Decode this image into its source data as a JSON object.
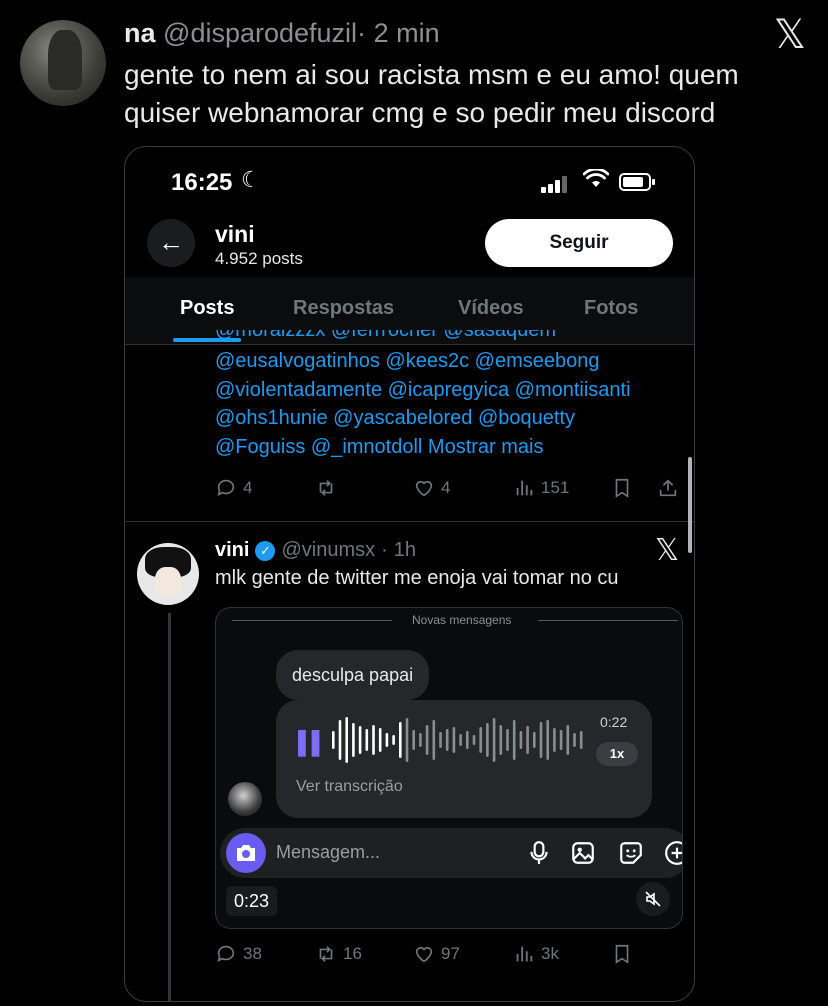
{
  "outer_tweet": {
    "display_name": "na",
    "handle": "@disparodefuzil",
    "separator": "·",
    "time": "2 min",
    "text": "gente to nem ai sou racista msm e eu amo! quem quiser webnamorar cmg e so pedir meu discord",
    "platform_logo": "x-logo"
  },
  "screenshot": {
    "status_bar": {
      "time": "16:25",
      "focus_icon": "moon-icon",
      "signal_icon": "cellular-signal-icon",
      "wifi_icon": "wifi-icon",
      "battery_icon": "battery-icon"
    },
    "profile_header": {
      "back_icon": "arrow-left-icon",
      "name": "vini",
      "posts_count": "4.952 posts",
      "follow_label": "Seguir"
    },
    "tabs": [
      {
        "label": "Posts",
        "active": true
      },
      {
        "label": "Respostas",
        "active": false
      },
      {
        "label": "Vídeos",
        "active": false
      },
      {
        "label": "Fotos",
        "active": false
      }
    ],
    "previous_post": {
      "mention_lines": [
        "@moraizzzx @ferrrocher @sasaquem",
        "@eusalvogatinhos @kees2c @emseebong",
        "@violentadamente @icapregyica @montiisanti",
        "@ohs1hunie @yascabelored @boquetty",
        "@Foguiss @_imnotdoll Mostrar mais"
      ],
      "stats": {
        "replies": "4",
        "retweets": "",
        "likes": "4",
        "views": "151"
      }
    },
    "post": {
      "name": "vini",
      "verified": true,
      "handle": "@vinumsx",
      "separator": "·",
      "time": "1h",
      "text": "mlk gente de twitter me enoja vai tomar no cu",
      "stats": {
        "replies": "38",
        "retweets": "16",
        "likes": "97",
        "views": "3k"
      },
      "embedded_dm": {
        "divider_label": "Novas mensagens",
        "text_message": "desculpa papai",
        "audio": {
          "duration": "0:22",
          "speed": "1x",
          "transcript_label": "Ver transcrição",
          "play_state_icon": "pause-icon",
          "accent": "#7d6df5"
        },
        "composer_placeholder": "Mensagem...",
        "composer_icons": [
          "camera-icon",
          "microphone-icon",
          "image-icon",
          "sticker-icon",
          "plus-icon"
        ],
        "video_time": "0:23",
        "mute_icon": "speaker-muted-icon"
      }
    }
  },
  "colors": {
    "background": "#000000",
    "link_blue": "#1d9bf0",
    "muted_text": "#71767b",
    "accent_purple": "#6a5cf0"
  }
}
